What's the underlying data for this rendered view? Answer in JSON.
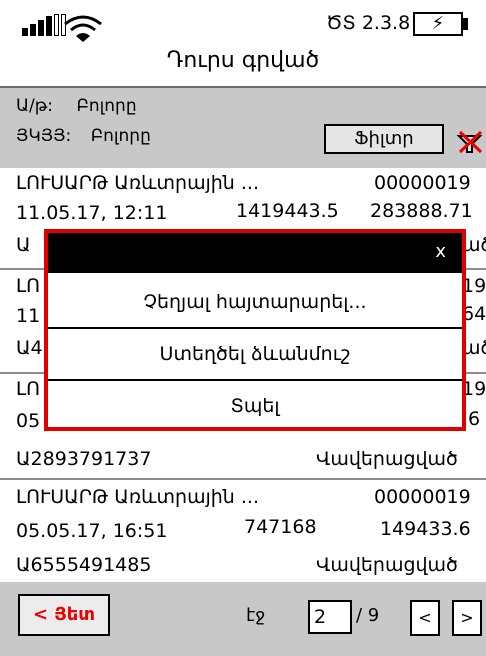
{
  "status": {
    "version": "ԾՏ 2.3.8",
    "battery_symbol": "⚡"
  },
  "title": "Դուրս գրված",
  "filter": {
    "row1_label": "Ա/թ:",
    "row1_value": "Բոլորը",
    "row2_label": "ՅԿՅՅ:",
    "row2_value": "Բոլորը",
    "button_label": "Ֆիլտր"
  },
  "items": [
    {
      "name": "ԼՈՒՍԱՐԹ Առևտրային ...",
      "code": "00000019",
      "datetime": "11.05.17, 12:11",
      "amount1": "1419443.5",
      "amount2": "283888.71",
      "id": "Ա",
      "status": "ած"
    },
    {
      "name": "ԼՈ",
      "code": "19",
      "datetime": "11",
      "amount1": "",
      "amount2": "64",
      "id": "Ա4",
      "status": "ած"
    },
    {
      "name": "ԼՈ",
      "code": "19",
      "datetime": "05",
      "amount1": "",
      "amount2": ".6",
      "id": "Ա2893791737",
      "status": "Վավերացված"
    },
    {
      "name": "ԼՈՒՍԱՐԹ Առևտրային ...",
      "code": "00000019",
      "datetime": "05.05.17, 16:51",
      "amount1": "747168",
      "amount2": "149433.6",
      "id": "Ա6555491485",
      "status": "Վավերացված"
    }
  ],
  "menu": {
    "close": "x",
    "items": [
      "Չեղյալ հայտարարել...",
      "Ստեղծել ձևանմուշ",
      "Տպել"
    ]
  },
  "bottom": {
    "back_label": "< Յետ",
    "page_word": "էջ",
    "page_value": "2",
    "page_total": "/ 9",
    "prev_label": "<",
    "next_label": ">"
  }
}
